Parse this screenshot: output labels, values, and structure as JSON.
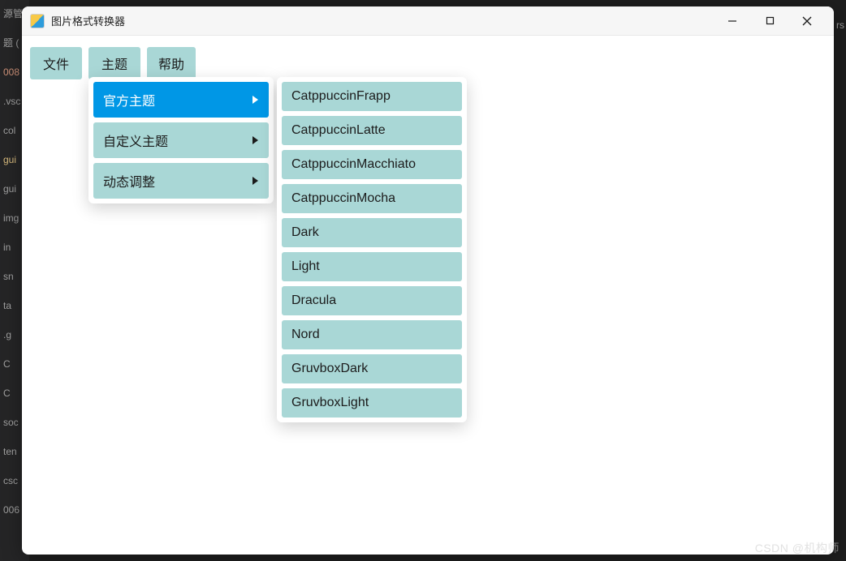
{
  "background": {
    "sidebar_items": [
      {
        "label": "源管理",
        "cls": ""
      },
      {
        "label": "题 (",
        "cls": ""
      },
      {
        "label": "008",
        "cls": "orange"
      },
      {
        "label": ".vsc",
        "cls": ""
      },
      {
        "label": "col",
        "cls": ""
      },
      {
        "label": "gui",
        "cls": "highlight"
      },
      {
        "label": "gui",
        "cls": ""
      },
      {
        "label": "img",
        "cls": ""
      },
      {
        "label": "in",
        "cls": ""
      },
      {
        "label": "sn",
        "cls": ""
      },
      {
        "label": "ta",
        "cls": ""
      },
      {
        "label": ".g",
        "cls": ""
      },
      {
        "label": "C",
        "cls": ""
      },
      {
        "label": "C",
        "cls": ""
      },
      {
        "label": "soc",
        "cls": ""
      },
      {
        "label": "ten",
        "cls": ""
      },
      {
        "label": "csc",
        "cls": ""
      },
      {
        "label": "006",
        "cls": ""
      }
    ],
    "right_text": "rs"
  },
  "window": {
    "title": "图片格式转换器"
  },
  "menubar": {
    "file": "文件",
    "theme": "主题",
    "help": "帮助"
  },
  "theme_menu": {
    "items": [
      {
        "label": "官方主题",
        "has_sub": true,
        "active": true
      },
      {
        "label": "自定义主题",
        "has_sub": true,
        "active": false
      },
      {
        "label": "动态调整",
        "has_sub": true,
        "active": false
      }
    ]
  },
  "official_themes": [
    "CatppuccinFrapp",
    "CatppuccinLatte",
    "CatppuccinMacchiato",
    "CatppuccinMocha",
    "Dark",
    "Light",
    "Dracula",
    "Nord",
    "GruvboxDark",
    "GruvboxLight"
  ],
  "watermark": "CSDN @机构师"
}
